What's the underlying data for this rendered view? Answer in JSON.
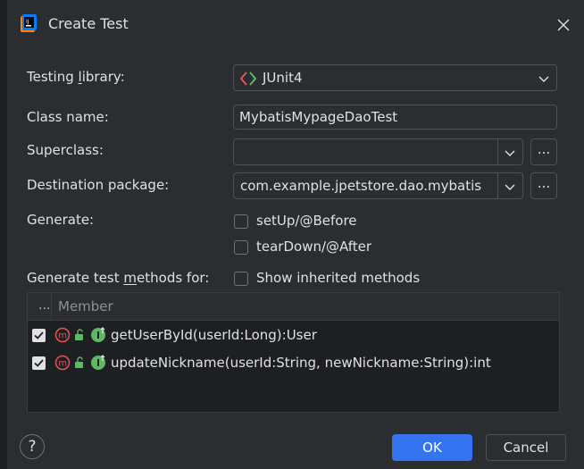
{
  "window": {
    "title": "Create Test"
  },
  "labels": {
    "testing_library_pre": "Testing ",
    "testing_library_u": "l",
    "testing_library_post": "ibrary:",
    "class_name": "Class name:",
    "superclass": "Superclass:",
    "destination_package": "Destination package:",
    "generate": "Generate:",
    "generate_methods_pre": "Generate test ",
    "generate_methods_u": "m",
    "generate_methods_post": "ethods for:"
  },
  "fields": {
    "testing_library": "JUnit4",
    "class_name": "MybatisMypageDaoTest",
    "superclass": "",
    "destination_package": "com.example.jpetstore.dao.mybatis",
    "browse_label": "..."
  },
  "options": {
    "setup": {
      "label": "setUp/@Before",
      "checked": false
    },
    "teardown": {
      "label": "tearDown/@After",
      "checked": false
    },
    "show_inherited": {
      "label": "Show inherited methods",
      "checked": false
    }
  },
  "table": {
    "dots_header": "...",
    "member_header": "Member",
    "rows": [
      {
        "checked": true,
        "text": "getUserById(userId:Long):User"
      },
      {
        "checked": true,
        "text": "updateNickname(userId:String, newNickname:String):int"
      }
    ]
  },
  "buttons": {
    "help": "?",
    "ok": "OK",
    "cancel": "Cancel"
  },
  "colors": {
    "background": "#2b2d30",
    "accent": "#3574f0",
    "border": "#4e5157",
    "table_bg": "#1e1f22"
  }
}
